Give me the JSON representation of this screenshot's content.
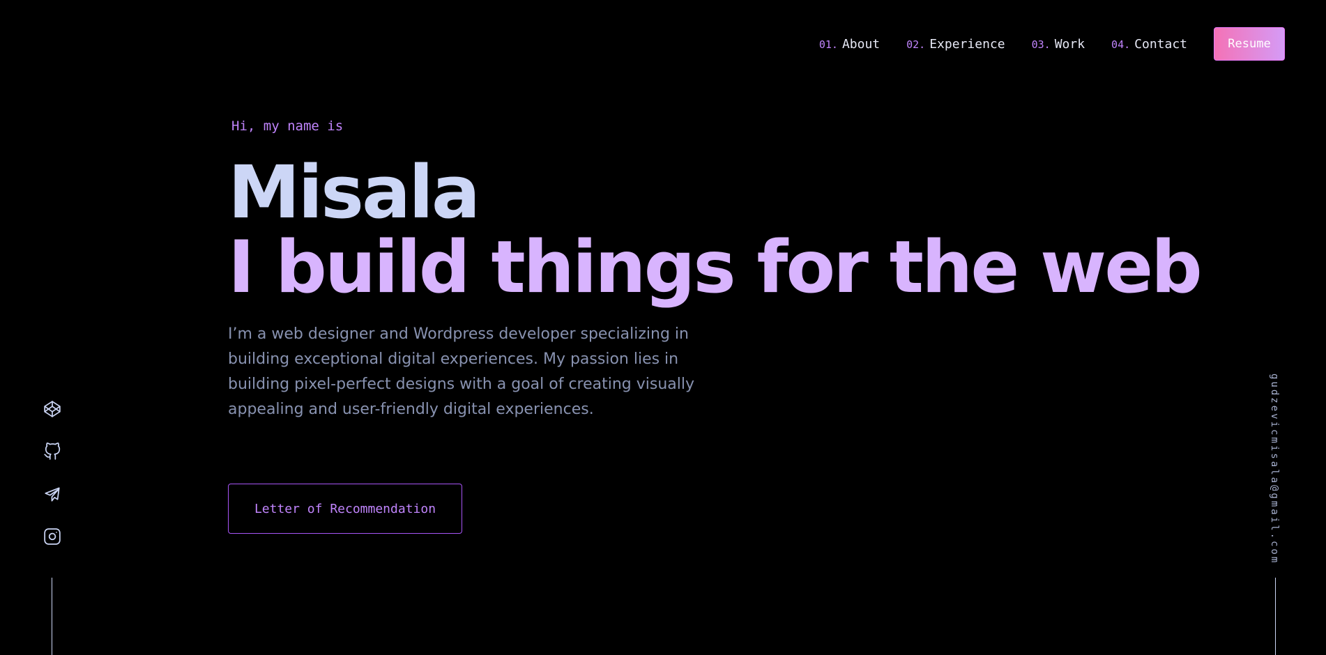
{
  "nav": {
    "items": [
      {
        "num": "01.",
        "label": "About"
      },
      {
        "num": "02.",
        "label": "Experience"
      },
      {
        "num": "03.",
        "label": "Work"
      },
      {
        "num": "04.",
        "label": "Contact"
      }
    ],
    "resume_label": "Resume"
  },
  "hero": {
    "greeting": "Hi, my name is",
    "name": "Misala",
    "tagline": "I build things for the web",
    "intro": "I’m a web designer and Wordpress developer specializing in building exceptional digital experiences.  My passion lies in building pixel-perfect designs with a goal of creating visually appealing and user-friendly digital experiences.",
    "cta_label": "Letter of Recommendation"
  },
  "social": {
    "icons": [
      "codepen-icon",
      "github-icon",
      "telegram-icon",
      "instagram-icon"
    ]
  },
  "email": "gudzevicmisala@gmail.com",
  "colors": {
    "background": "#000000",
    "accent": "#c084fc",
    "name": "#ccd6f6",
    "tagline": "#d8b4fe",
    "text": "#8892b0",
    "resume_gradient_start": "#f472b6",
    "resume_gradient_end": "#d59bf6"
  }
}
